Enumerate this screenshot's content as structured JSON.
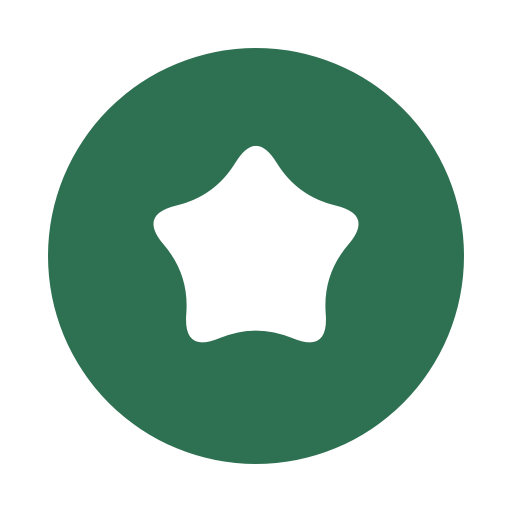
{
  "app_icon": {
    "icon": "rounded-star-icon",
    "background_shape": "circle",
    "colors": {
      "background": "#2e7052",
      "star": "#ffffff",
      "page": "#ffffff"
    }
  }
}
